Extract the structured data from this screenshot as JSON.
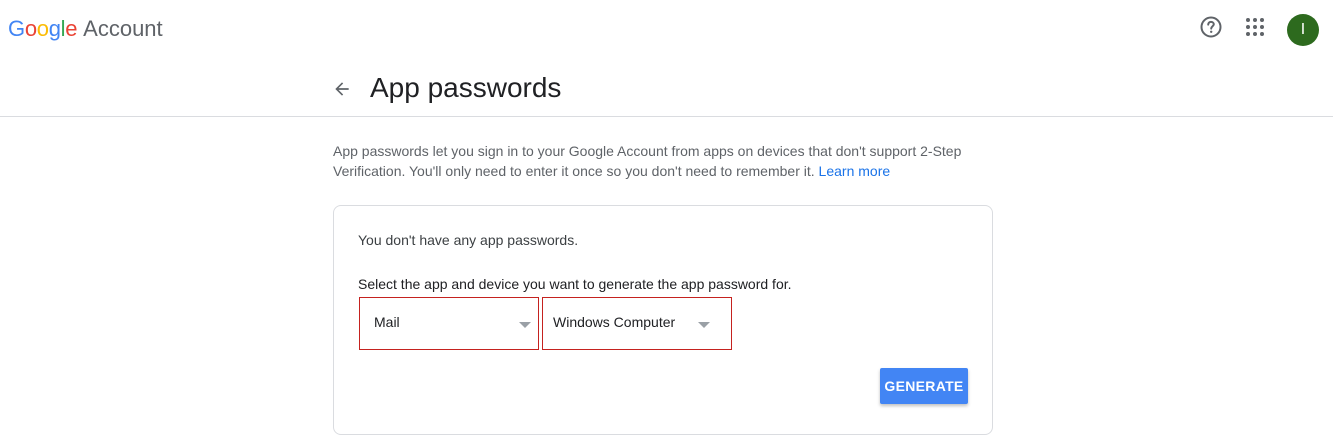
{
  "header": {
    "logo": {
      "letters": [
        {
          "char": "G",
          "color": "#4285f4"
        },
        {
          "char": "o",
          "color": "#ea4335"
        },
        {
          "char": "o",
          "color": "#fbbc05"
        },
        {
          "char": "g",
          "color": "#4285f4"
        },
        {
          "char": "l",
          "color": "#34a853"
        },
        {
          "char": "e",
          "color": "#ea4335"
        }
      ],
      "product": "Account"
    },
    "help_icon": "help-circle-icon",
    "apps_icon": "apps-grid-icon",
    "avatar": {
      "initial": "I",
      "color": "#2d6a1e"
    }
  },
  "page": {
    "back_icon": "arrow-left-icon",
    "title": "App passwords",
    "intro_text": "App passwords let you sign in to your Google Account from apps on devices that don't support 2-Step Verification. You'll only need to enter it once so you don't need to remember it.",
    "learn_more": "Learn more"
  },
  "card": {
    "no_passwords": "You don't have any app passwords.",
    "select_label": "Select the app and device you want to generate the app password for.",
    "app_select": {
      "value": "Mail"
    },
    "device_select": {
      "value": "Windows Computer"
    },
    "generate_label": "GENERATE"
  },
  "colors": {
    "accent": "#4285f4",
    "link": "#1a73e8",
    "highlight_border": "#c5221f"
  }
}
